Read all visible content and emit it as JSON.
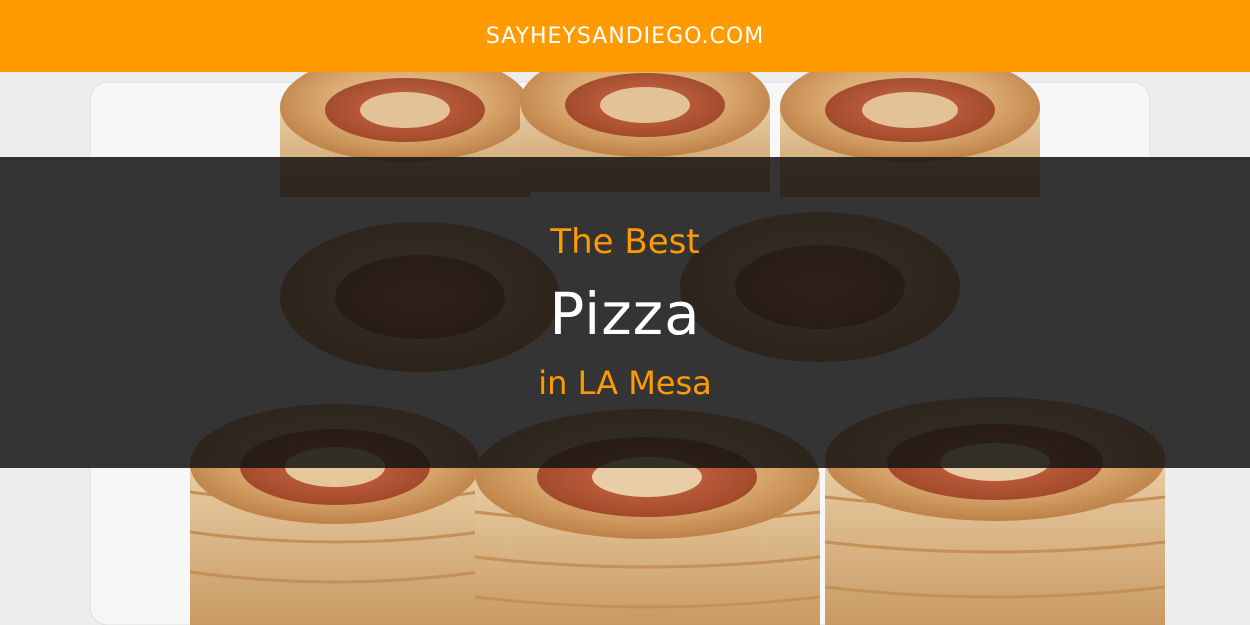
{
  "header": {
    "site_name": "SAYHEYSANDIEGO.COM"
  },
  "headline": {
    "line_1": "The Best",
    "line_2": "Pizza",
    "line_3": "in LA Mesa"
  },
  "colors": {
    "accent": "#ff9a00",
    "overlay": "#141414",
    "headline_main": "#ffffff"
  },
  "image": {
    "subject": "pizza-pinwheel-rolls-photo"
  }
}
